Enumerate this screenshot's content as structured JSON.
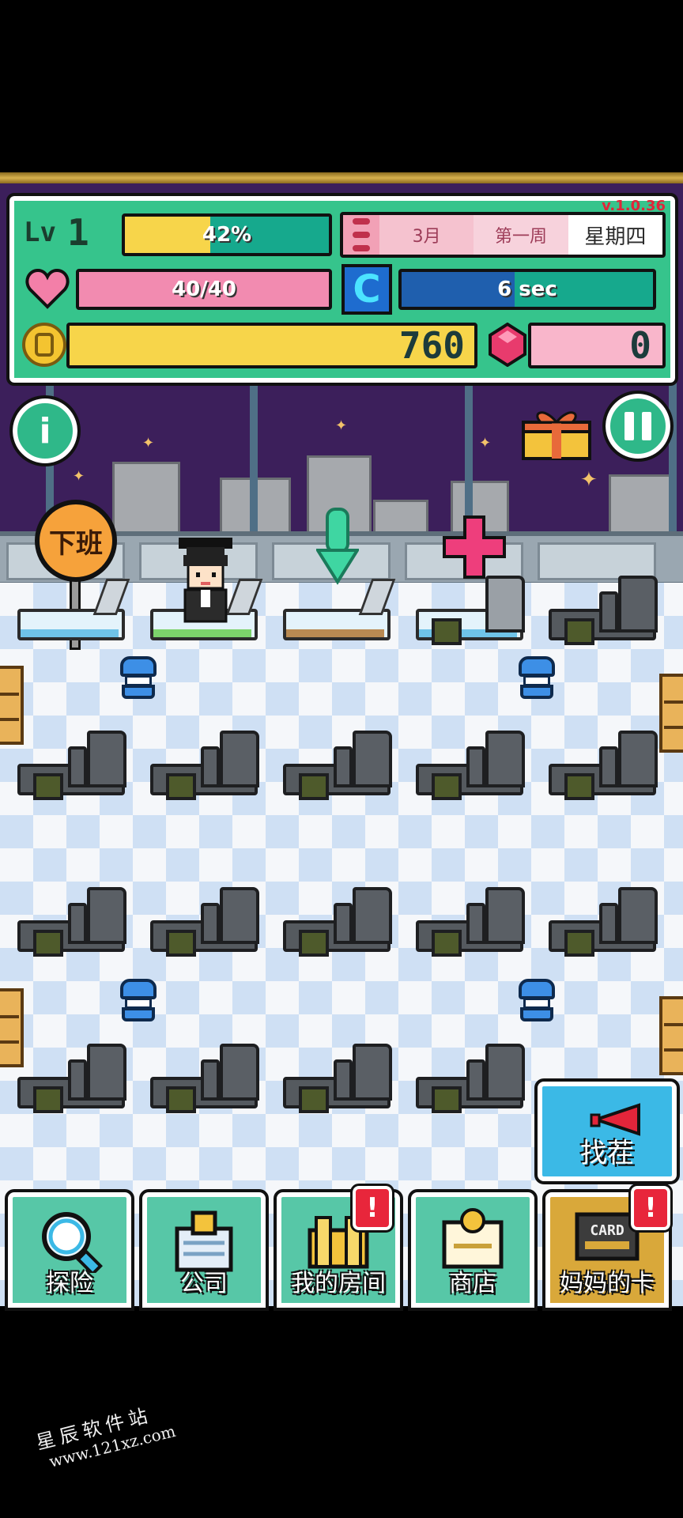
{
  "version": "v.1.0.36",
  "hud": {
    "level_prefix": "Lv",
    "level": "1",
    "exp_text": "42%",
    "exp_fraction": 0.42,
    "calendar": {
      "month": "3月",
      "week": "第一周",
      "day": "星期四"
    },
    "hp_text": "40/40",
    "hp_fraction": 1.0,
    "timer_icon_letter": "C",
    "timer_text": "6 sec",
    "timer_fraction": 0.45,
    "gold": "760",
    "gems": "0"
  },
  "icons": {
    "info": "info-icon",
    "pause": "pause-icon",
    "gift": "gift-icon",
    "heart": "heart-icon",
    "clock": "clock-icon",
    "coin": "coin-icon",
    "gem": "gem-icon"
  },
  "info_letter": "i",
  "sign_text": "下班",
  "find_button": {
    "label": "找茬"
  },
  "nav": [
    {
      "label": "探险",
      "icon": "magnifier-icon",
      "alert": ""
    },
    {
      "label": "公司",
      "icon": "company-icon",
      "alert": ""
    },
    {
      "label": "我的房间",
      "icon": "room-icon",
      "alert": "!"
    },
    {
      "label": "商店",
      "icon": "shop-icon",
      "alert": ""
    },
    {
      "label": "妈妈的卡",
      "icon": "card-icon",
      "alert": "!"
    }
  ],
  "card_icon_text": "CARD",
  "watermark": {
    "name": "星辰软件站",
    "url": "www.121xz.com"
  },
  "colors": {
    "hud_bg": "#36c48c",
    "exp": "#f7d54a",
    "hp": "#f28bb0",
    "timer": "#1f5fae",
    "gold_bar": "#f7d54a",
    "gem_bar": "#f9b6cb",
    "alert": "#e8263b"
  }
}
